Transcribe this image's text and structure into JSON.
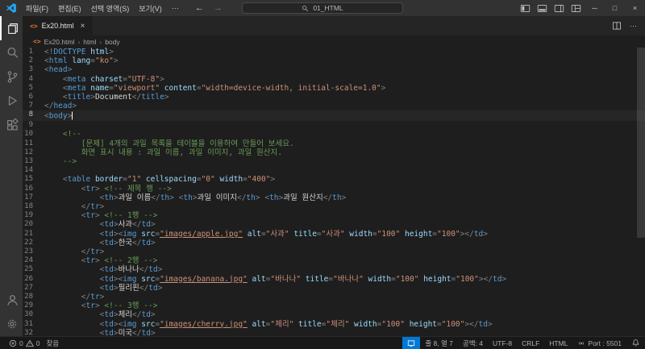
{
  "title_bar": {
    "menus": [
      {
        "label": "파일(F)"
      },
      {
        "label": "편집(E)"
      },
      {
        "label": "선택 영역(S)"
      },
      {
        "label": "보기(V)"
      },
      {
        "label": "···"
      }
    ],
    "search_value": "01_HTML"
  },
  "tab": {
    "label": "Ex20.html"
  },
  "breadcrumb": {
    "items": [
      "Ex20.html",
      "html",
      "body"
    ]
  },
  "editor": {
    "cursor_line": 8,
    "lines": [
      [
        [
          "p",
          "<!"
        ],
        [
          "t",
          "DOCTYPE"
        ],
        [
          "a",
          " html"
        ],
        [
          "p",
          ">"
        ]
      ],
      [
        [
          "p",
          "<"
        ],
        [
          "t",
          "html"
        ],
        [
          "a",
          " lang"
        ],
        [
          "p",
          "="
        ],
        [
          "s",
          "\"ko\""
        ],
        [
          "p",
          ">"
        ]
      ],
      [
        [
          "p",
          "<"
        ],
        [
          "t",
          "head"
        ],
        [
          "p",
          ">"
        ]
      ],
      [
        [
          "x",
          "    "
        ],
        [
          "p",
          "<"
        ],
        [
          "t",
          "meta"
        ],
        [
          "a",
          " charset"
        ],
        [
          "p",
          "="
        ],
        [
          "s",
          "\"UTF-8\""
        ],
        [
          "p",
          ">"
        ]
      ],
      [
        [
          "x",
          "    "
        ],
        [
          "p",
          "<"
        ],
        [
          "t",
          "meta"
        ],
        [
          "a",
          " name"
        ],
        [
          "p",
          "="
        ],
        [
          "s",
          "\"viewport\""
        ],
        [
          "a",
          " content"
        ],
        [
          "p",
          "="
        ],
        [
          "s",
          "\"width=device-width, initial-scale=1.0\""
        ],
        [
          "p",
          ">"
        ]
      ],
      [
        [
          "x",
          "    "
        ],
        [
          "p",
          "<"
        ],
        [
          "t",
          "title"
        ],
        [
          "p",
          ">"
        ],
        [
          "x",
          "Document"
        ],
        [
          "p",
          "</"
        ],
        [
          "t",
          "title"
        ],
        [
          "p",
          ">"
        ]
      ],
      [
        [
          "p",
          "</"
        ],
        [
          "t",
          "head"
        ],
        [
          "p",
          ">"
        ]
      ],
      [
        [
          "p",
          "<"
        ],
        [
          "t",
          "body"
        ],
        [
          "p",
          ">"
        ]
      ],
      [],
      [
        [
          "c",
          "    <!--"
        ]
      ],
      [
        [
          "c",
          "        [문제] 4개의 과일 목록을 테이블을 이용하여 만들어 보세요."
        ]
      ],
      [
        [
          "c",
          "        화면 표시 내용 : 과일 이름, 과일 이미지, 과일 원산지."
        ]
      ],
      [
        [
          "c",
          "    -->"
        ]
      ],
      [],
      [
        [
          "x",
          "    "
        ],
        [
          "p",
          "<"
        ],
        [
          "t",
          "table"
        ],
        [
          "a",
          " border"
        ],
        [
          "p",
          "="
        ],
        [
          "s",
          "\"1\""
        ],
        [
          "a",
          " cellspacing"
        ],
        [
          "p",
          "="
        ],
        [
          "s",
          "\"0\""
        ],
        [
          "a",
          " width"
        ],
        [
          "p",
          "="
        ],
        [
          "s",
          "\"400\""
        ],
        [
          "p",
          ">"
        ]
      ],
      [
        [
          "x",
          "        "
        ],
        [
          "p",
          "<"
        ],
        [
          "t",
          "tr"
        ],
        [
          "p",
          ">"
        ],
        [
          "c",
          " <!-- 제목 행 -->"
        ]
      ],
      [
        [
          "x",
          "            "
        ],
        [
          "p",
          "<"
        ],
        [
          "t",
          "th"
        ],
        [
          "p",
          ">"
        ],
        [
          "x",
          "과일 이름"
        ],
        [
          "p",
          "</"
        ],
        [
          "t",
          "th"
        ],
        [
          "p",
          ">"
        ],
        [
          "x",
          " "
        ],
        [
          "p",
          "<"
        ],
        [
          "t",
          "th"
        ],
        [
          "p",
          ">"
        ],
        [
          "x",
          "과일 이미지"
        ],
        [
          "p",
          "</"
        ],
        [
          "t",
          "th"
        ],
        [
          "p",
          ">"
        ],
        [
          "x",
          " "
        ],
        [
          "p",
          "<"
        ],
        [
          "t",
          "th"
        ],
        [
          "p",
          ">"
        ],
        [
          "x",
          "과일 원산지"
        ],
        [
          "p",
          "</"
        ],
        [
          "t",
          "th"
        ],
        [
          "p",
          ">"
        ]
      ],
      [
        [
          "x",
          "        "
        ],
        [
          "p",
          "</"
        ],
        [
          "t",
          "tr"
        ],
        [
          "p",
          ">"
        ]
      ],
      [
        [
          "x",
          "        "
        ],
        [
          "p",
          "<"
        ],
        [
          "t",
          "tr"
        ],
        [
          "p",
          ">"
        ],
        [
          "c",
          " <!-- 1행 -->"
        ]
      ],
      [
        [
          "x",
          "            "
        ],
        [
          "p",
          "<"
        ],
        [
          "t",
          "td"
        ],
        [
          "p",
          ">"
        ],
        [
          "x",
          "사과"
        ],
        [
          "p",
          "</"
        ],
        [
          "t",
          "td"
        ],
        [
          "p",
          ">"
        ]
      ],
      [
        [
          "x",
          "            "
        ],
        [
          "p",
          "<"
        ],
        [
          "t",
          "td"
        ],
        [
          "p",
          ">"
        ],
        [
          "p",
          "<"
        ],
        [
          "t",
          "img"
        ],
        [
          "a",
          " src"
        ],
        [
          "p",
          "="
        ],
        [
          "u",
          "\"images/apple.jpg\""
        ],
        [
          "a",
          " alt"
        ],
        [
          "p",
          "="
        ],
        [
          "s",
          "\"사과\""
        ],
        [
          "a",
          " title"
        ],
        [
          "p",
          "="
        ],
        [
          "s",
          "\"사과\""
        ],
        [
          "a",
          " width"
        ],
        [
          "p",
          "="
        ],
        [
          "s",
          "\"100\""
        ],
        [
          "a",
          " height"
        ],
        [
          "p",
          "="
        ],
        [
          "s",
          "\"100\""
        ],
        [
          "p",
          ">"
        ],
        [
          "p",
          "</"
        ],
        [
          "t",
          "td"
        ],
        [
          "p",
          ">"
        ]
      ],
      [
        [
          "x",
          "            "
        ],
        [
          "p",
          "<"
        ],
        [
          "t",
          "td"
        ],
        [
          "p",
          ">"
        ],
        [
          "x",
          "한국"
        ],
        [
          "p",
          "</"
        ],
        [
          "t",
          "td"
        ],
        [
          "p",
          ">"
        ]
      ],
      [
        [
          "x",
          "        "
        ],
        [
          "p",
          "</"
        ],
        [
          "t",
          "tr"
        ],
        [
          "p",
          ">"
        ]
      ],
      [
        [
          "x",
          "        "
        ],
        [
          "p",
          "<"
        ],
        [
          "t",
          "tr"
        ],
        [
          "p",
          ">"
        ],
        [
          "c",
          " <!-- 2행 -->"
        ]
      ],
      [
        [
          "x",
          "            "
        ],
        [
          "p",
          "<"
        ],
        [
          "t",
          "td"
        ],
        [
          "p",
          ">"
        ],
        [
          "x",
          "바나나"
        ],
        [
          "p",
          "</"
        ],
        [
          "t",
          "td"
        ],
        [
          "p",
          ">"
        ]
      ],
      [
        [
          "x",
          "            "
        ],
        [
          "p",
          "<"
        ],
        [
          "t",
          "td"
        ],
        [
          "p",
          ">"
        ],
        [
          "p",
          "<"
        ],
        [
          "t",
          "img"
        ],
        [
          "a",
          " src"
        ],
        [
          "p",
          "="
        ],
        [
          "u",
          "\"images/banana.jpg\""
        ],
        [
          "a",
          " alt"
        ],
        [
          "p",
          "="
        ],
        [
          "s",
          "\"바나나\""
        ],
        [
          "a",
          " title"
        ],
        [
          "p",
          "="
        ],
        [
          "s",
          "\"바나나\""
        ],
        [
          "a",
          " width"
        ],
        [
          "p",
          "="
        ],
        [
          "s",
          "\"100\""
        ],
        [
          "a",
          " height"
        ],
        [
          "p",
          "="
        ],
        [
          "s",
          "\"100\""
        ],
        [
          "p",
          ">"
        ],
        [
          "p",
          "</"
        ],
        [
          "t",
          "td"
        ],
        [
          "p",
          ">"
        ]
      ],
      [
        [
          "x",
          "            "
        ],
        [
          "p",
          "<"
        ],
        [
          "t",
          "td"
        ],
        [
          "p",
          ">"
        ],
        [
          "x",
          "필리핀"
        ],
        [
          "p",
          "</"
        ],
        [
          "t",
          "td"
        ],
        [
          "p",
          ">"
        ]
      ],
      [
        [
          "x",
          "        "
        ],
        [
          "p",
          "</"
        ],
        [
          "t",
          "tr"
        ],
        [
          "p",
          ">"
        ]
      ],
      [
        [
          "x",
          "        "
        ],
        [
          "p",
          "<"
        ],
        [
          "t",
          "tr"
        ],
        [
          "p",
          ">"
        ],
        [
          "c",
          " <!-- 3행 -->"
        ]
      ],
      [
        [
          "x",
          "            "
        ],
        [
          "p",
          "<"
        ],
        [
          "t",
          "td"
        ],
        [
          "p",
          ">"
        ],
        [
          "x",
          "체리"
        ],
        [
          "p",
          "</"
        ],
        [
          "t",
          "td"
        ],
        [
          "p",
          ">"
        ]
      ],
      [
        [
          "x",
          "            "
        ],
        [
          "p",
          "<"
        ],
        [
          "t",
          "td"
        ],
        [
          "p",
          ">"
        ],
        [
          "p",
          "<"
        ],
        [
          "t",
          "img"
        ],
        [
          "a",
          " src"
        ],
        [
          "p",
          "="
        ],
        [
          "u",
          "\"images/cherry.jpg\""
        ],
        [
          "a",
          " alt"
        ],
        [
          "p",
          "="
        ],
        [
          "s",
          "\"체리\""
        ],
        [
          "a",
          " title"
        ],
        [
          "p",
          "="
        ],
        [
          "s",
          "\"체리\""
        ],
        [
          "a",
          " width"
        ],
        [
          "p",
          "="
        ],
        [
          "s",
          "\"100\""
        ],
        [
          "a",
          " height"
        ],
        [
          "p",
          "="
        ],
        [
          "s",
          "\"100\""
        ],
        [
          "p",
          ">"
        ],
        [
          "p",
          "</"
        ],
        [
          "t",
          "td"
        ],
        [
          "p",
          ">"
        ]
      ],
      [
        [
          "x",
          "            "
        ],
        [
          "p",
          "<"
        ],
        [
          "t",
          "td"
        ],
        [
          "p",
          ">"
        ],
        [
          "x",
          "미국"
        ],
        [
          "p",
          "</"
        ],
        [
          "t",
          "td"
        ],
        [
          "p",
          ">"
        ]
      ]
    ]
  },
  "status_bar": {
    "errors": "0",
    "warnings": "0",
    "info_label": "찾음",
    "line_col": "줄 8, 열 7",
    "indent": "공백: 4",
    "encoding": "UTF-8",
    "eol": "CRLF",
    "language": "HTML",
    "live_server": "Port : 5501"
  },
  "glyphs": {
    "back": "←",
    "forward": "→",
    "minimize": "─",
    "maximize": "□",
    "close": "×",
    "tab_close": "×",
    "more": "···",
    "crumb_sep": "›",
    "html_file": "<>"
  },
  "colors": {
    "accent": "#0078d4",
    "titlebar_bg": "#323233",
    "activitybar_bg": "#333333",
    "tabbar_bg": "#252526",
    "editor_bg": "#1e1e1e",
    "statusbar_bg": "#181818",
    "tokens": {
      "p": "#808080",
      "t": "#569cd6",
      "a": "#9cdcfe",
      "s": "#ce9178",
      "u": "#ce9178",
      "x": "#d4d4d4",
      "c": "#6a9955"
    }
  }
}
